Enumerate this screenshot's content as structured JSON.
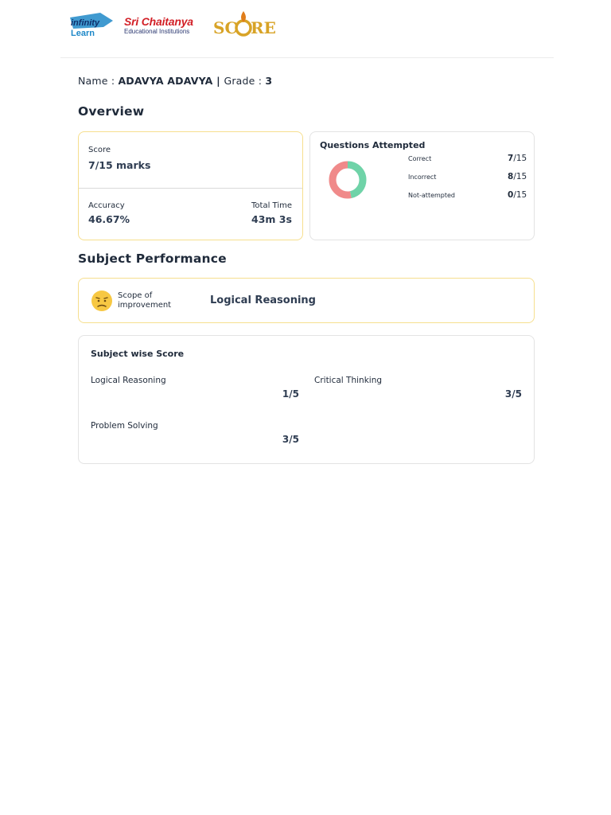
{
  "header": {
    "logo_infinity": "infinity learn",
    "logo_sc_line1": "Sri Chaitanya",
    "logo_sc_line2": "Educational Institutions",
    "logo_score": "SCORE"
  },
  "student": {
    "name_label": "Name : ",
    "name_value": "ADAVYA ADAVYA",
    "separator": " | ",
    "grade_label": "Grade : ",
    "grade_value": "3"
  },
  "overview": {
    "title": "Overview",
    "score_label": "Score",
    "score_value": "7/15 marks",
    "accuracy_label": "Accuracy",
    "accuracy_value": "46.67%",
    "time_label": "Total Time",
    "time_value": "43m 3s"
  },
  "questions": {
    "title": "Questions Attempted",
    "total": 15,
    "rows": [
      {
        "label": "Correct",
        "count": "7",
        "suffix": "/15",
        "color": "#6fd3a8"
      },
      {
        "label": "Incorrect",
        "count": "8",
        "suffix": "/15",
        "color": "#f08a8a"
      },
      {
        "label": "Not-attempted",
        "count": "0",
        "suffix": "/15",
        "color": "#cfcfcf"
      }
    ]
  },
  "subject_performance": {
    "title": "Subject Performance",
    "icon": "worried-face-icon",
    "status_line1": "Scope of",
    "status_line2": "improvement",
    "subject": "Logical Reasoning"
  },
  "subject_wise": {
    "title": "Subject wise Score",
    "items": [
      {
        "name": "Logical Reasoning",
        "score": "1/5"
      },
      {
        "name": "Critical Thinking",
        "score": "3/5"
      },
      {
        "name": "Problem Solving",
        "score": "3/5"
      }
    ]
  },
  "colors": {
    "accent_border": "#f6df8e",
    "correct": "#6fd3a8",
    "incorrect": "#f08a8a"
  }
}
